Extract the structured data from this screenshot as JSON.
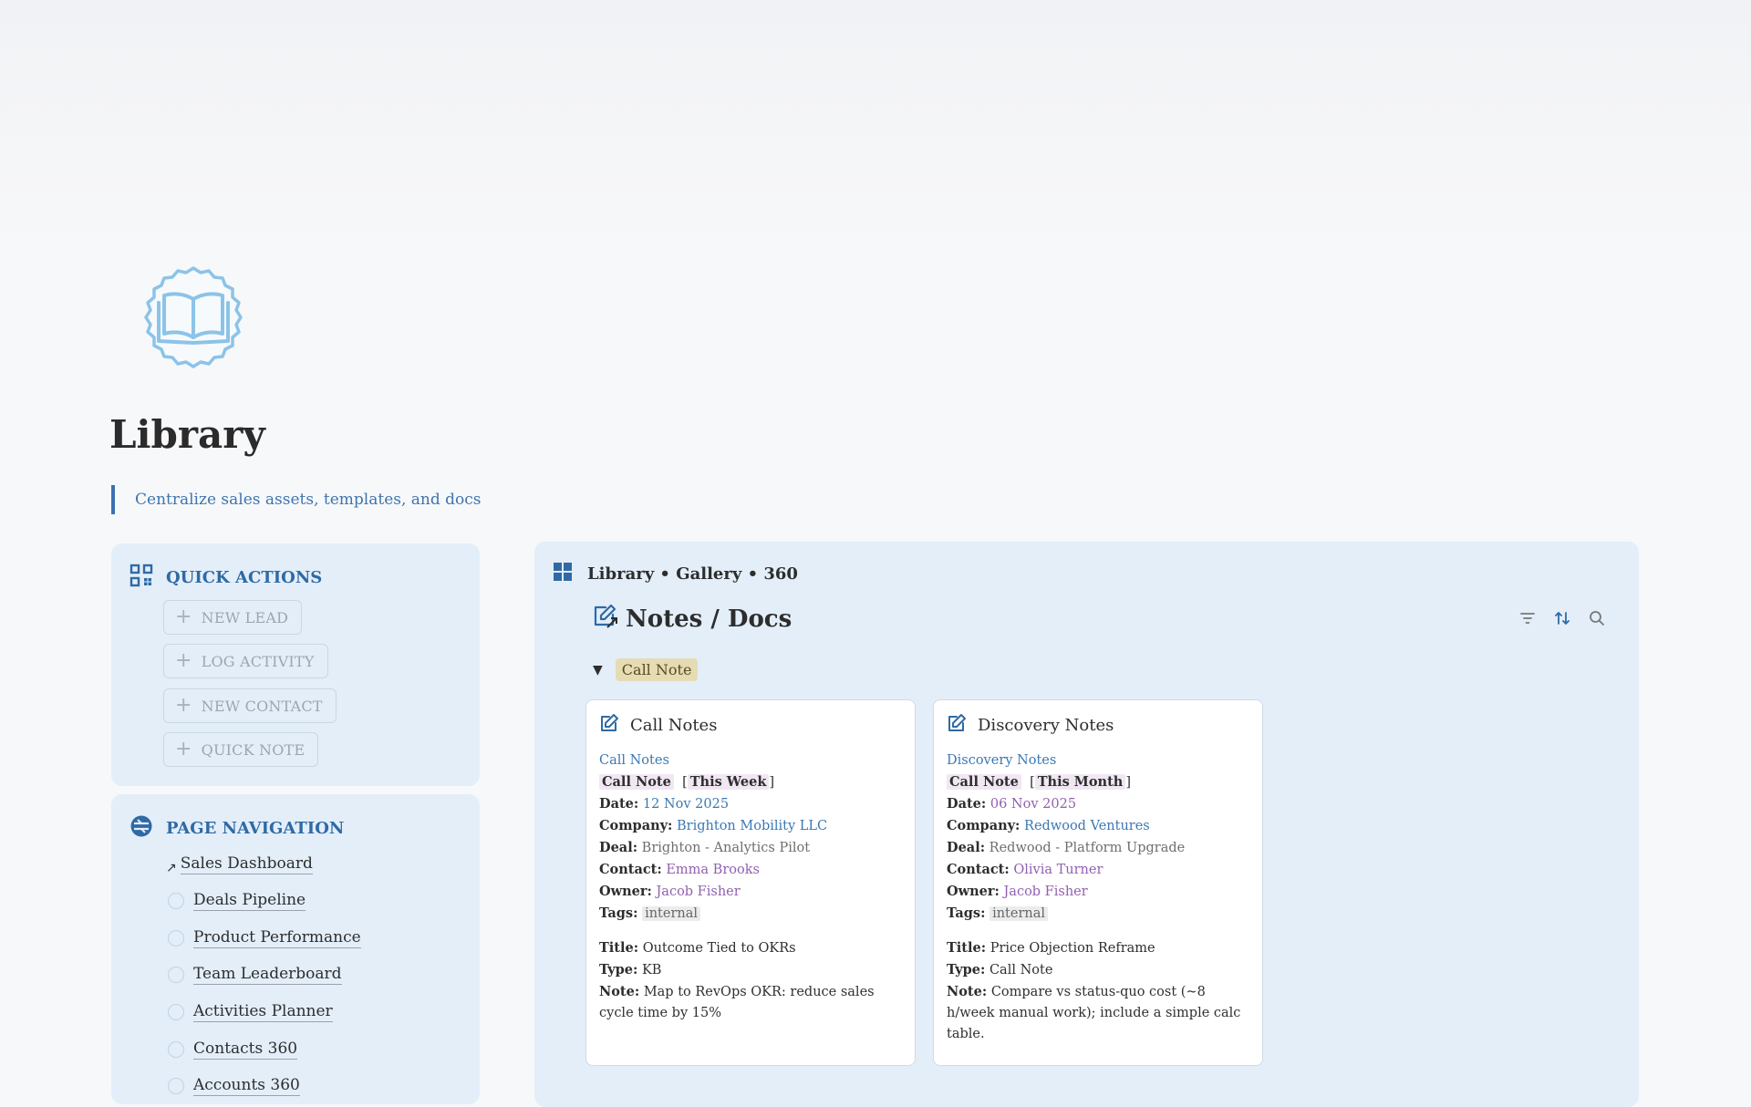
{
  "page": {
    "title": "Library",
    "subtitle": "Centralize sales assets, templates, and docs",
    "icon": "open-book-icon"
  },
  "colors": {
    "accent": "#2f6aa5",
    "panel": "#e3eef9",
    "link": "#3b78b3",
    "person": "#9160b0"
  },
  "quick_actions": {
    "heading": "QUICK ACTIONS",
    "icon": "qr-grid-icon",
    "buttons": [
      "NEW LEAD",
      "LOG ACTIVITY",
      "NEW CONTACT",
      "QUICK NOTE"
    ]
  },
  "page_navigation": {
    "heading": "PAGE NAVIGATION",
    "icon": "compass-icon",
    "items": [
      "Sales Dashboard",
      "Deals Pipeline",
      "Product Performance",
      "Team Leaderboard",
      "Activities Planner",
      "Contacts 360",
      "Accounts 360"
    ]
  },
  "gallery": {
    "header": "Library • Gallery • 360",
    "view_title": "Notes / Docs",
    "group": "Call Note",
    "cards": [
      {
        "title": "Call Notes",
        "link": "Call Notes",
        "type_pill": "Call Note",
        "period": "This Week",
        "date_label": "Date:",
        "date": "12 Nov 2025",
        "company_label": "Company:",
        "company": "Brighton Mobility LLC",
        "deal_label": "Deal:",
        "deal": "Brighton - Analytics Pilot",
        "contact_label": "Contact:",
        "contact": "Emma Brooks",
        "owner_label": "Owner:",
        "owner": "Jacob Fisher",
        "tags_label": "Tags:",
        "tags": "internal",
        "title_label": "Title:",
        "doc_title": "Outcome Tied to OKRs",
        "type_label": "Type:",
        "type": "KB",
        "note_label": "Note:",
        "note": "Map to RevOps OKR: reduce sales cycle time by 15%"
      },
      {
        "title": "Discovery Notes",
        "link": "Discovery Notes",
        "type_pill": "Call Note",
        "period": "This Month",
        "date_label": "Date:",
        "date": "06 Nov 2025",
        "company_label": "Company:",
        "company": "Redwood Ventures",
        "deal_label": "Deal:",
        "deal": "Redwood - Platform Upgrade",
        "contact_label": "Contact:",
        "contact": "Olivia Turner",
        "owner_label": "Owner:",
        "owner": "Jacob Fisher",
        "tags_label": "Tags:",
        "tags": "internal",
        "title_label": "Title:",
        "doc_title": "Price Objection Reframe",
        "type_label": "Type:",
        "type": "Call Note",
        "note_label": "Note:",
        "note": "Compare vs status-quo cost (~8 h/week manual work); include a simple calc table."
      }
    ]
  }
}
